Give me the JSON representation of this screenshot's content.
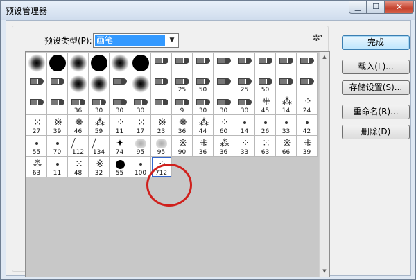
{
  "window": {
    "title": "预设管理器"
  },
  "preset_type": {
    "label": "预设类型(P):",
    "value": "画笔"
  },
  "buttons": {
    "done": "完成",
    "load": "载入(L)...",
    "save": "存储设置(S)...",
    "rename": "重命名(R)...",
    "delete": "删除(D)"
  },
  "brushes": [
    {
      "kind": "round-soft",
      "size": ""
    },
    {
      "kind": "round-hard",
      "size": ""
    },
    {
      "kind": "round-soft",
      "size": ""
    },
    {
      "kind": "round-hard",
      "size": ""
    },
    {
      "kind": "round-soft",
      "size": ""
    },
    {
      "kind": "round-hard",
      "size": ""
    },
    {
      "kind": "pen",
      "size": ""
    },
    {
      "kind": "pen",
      "size": ""
    },
    {
      "kind": "pen",
      "size": ""
    },
    {
      "kind": "pen",
      "size": ""
    },
    {
      "kind": "pen",
      "size": ""
    },
    {
      "kind": "pen",
      "size": ""
    },
    {
      "kind": "pen",
      "size": ""
    },
    {
      "kind": "pen",
      "size": ""
    },
    {
      "kind": "pen",
      "size": ""
    },
    {
      "kind": "pen",
      "size": ""
    },
    {
      "kind": "round-soft",
      "size": ""
    },
    {
      "kind": "round-soft",
      "size": ""
    },
    {
      "kind": "pen",
      "size": ""
    },
    {
      "kind": "round-soft",
      "size": ""
    },
    {
      "kind": "pen",
      "size": ""
    },
    {
      "kind": "pen",
      "size": "25"
    },
    {
      "kind": "pen",
      "size": "50"
    },
    {
      "kind": "pen",
      "size": ""
    },
    {
      "kind": "pen",
      "size": "25"
    },
    {
      "kind": "pen",
      "size": "50"
    },
    {
      "kind": "pen",
      "size": ""
    },
    {
      "kind": "pen",
      "size": ""
    },
    {
      "kind": "pen",
      "size": ""
    },
    {
      "kind": "pen",
      "size": ""
    },
    {
      "kind": "pen",
      "size": "36"
    },
    {
      "kind": "pen",
      "size": "30"
    },
    {
      "kind": "pen",
      "size": "30"
    },
    {
      "kind": "pen",
      "size": "30"
    },
    {
      "kind": "pen",
      "size": ""
    },
    {
      "kind": "pen",
      "size": "9"
    },
    {
      "kind": "pen",
      "size": "30"
    },
    {
      "kind": "pen",
      "size": "30"
    },
    {
      "kind": "pen",
      "size": "30"
    },
    {
      "kind": "splat",
      "size": "45"
    },
    {
      "kind": "splat",
      "size": "14"
    },
    {
      "kind": "splat",
      "size": "24"
    },
    {
      "kind": "splat",
      "size": "27"
    },
    {
      "kind": "splat",
      "size": "39"
    },
    {
      "kind": "splat",
      "size": "46"
    },
    {
      "kind": "splat",
      "size": "59"
    },
    {
      "kind": "splat",
      "size": "11"
    },
    {
      "kind": "splat",
      "size": "17"
    },
    {
      "kind": "splat",
      "size": "23"
    },
    {
      "kind": "splat",
      "size": "36"
    },
    {
      "kind": "splat",
      "size": "44"
    },
    {
      "kind": "splat",
      "size": "60"
    },
    {
      "kind": "dot",
      "size": "14"
    },
    {
      "kind": "dot",
      "size": "26"
    },
    {
      "kind": "dot",
      "size": "33"
    },
    {
      "kind": "dot",
      "size": "42"
    },
    {
      "kind": "dot",
      "size": "55"
    },
    {
      "kind": "dot",
      "size": "70"
    },
    {
      "kind": "grass",
      "size": "112"
    },
    {
      "kind": "grass",
      "size": "134"
    },
    {
      "kind": "leaf",
      "size": "74"
    },
    {
      "kind": "soft-gray",
      "size": "95"
    },
    {
      "kind": "soft-gray",
      "size": "95"
    },
    {
      "kind": "splat",
      "size": "90"
    },
    {
      "kind": "splat",
      "size": "36"
    },
    {
      "kind": "splat",
      "size": "36"
    },
    {
      "kind": "splat",
      "size": "33"
    },
    {
      "kind": "splat",
      "size": "63"
    },
    {
      "kind": "splat",
      "size": "66"
    },
    {
      "kind": "splat",
      "size": "39"
    },
    {
      "kind": "splat",
      "size": "63"
    },
    {
      "kind": "dot",
      "size": "11"
    },
    {
      "kind": "splat",
      "size": "48"
    },
    {
      "kind": "splat",
      "size": "32"
    },
    {
      "kind": "round-small",
      "size": "55"
    },
    {
      "kind": "dot",
      "size": "100"
    },
    {
      "kind": "splat",
      "size": "712",
      "selected": true
    }
  ],
  "colors": {
    "highlight_ring": "#d0201c",
    "selection": "#3399ff"
  }
}
